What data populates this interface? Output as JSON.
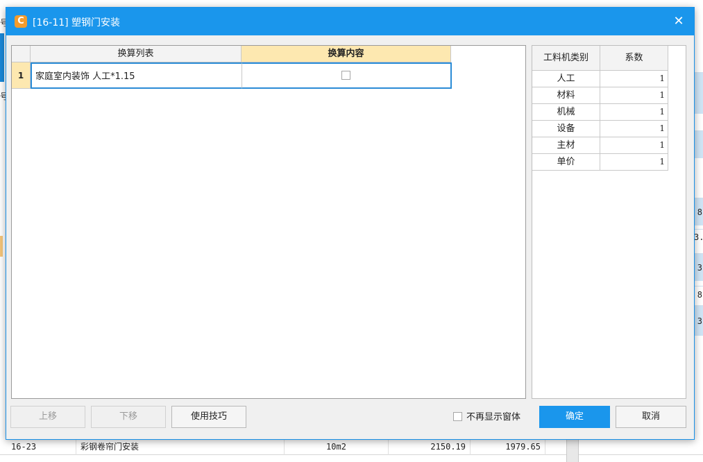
{
  "dialog": {
    "title": "[16-11] 塑钢门安装",
    "close_glyph": "✕",
    "app_icon_glyph": "C"
  },
  "left_grid": {
    "col_list": "换算列表",
    "col_content": "换算内容",
    "rows": [
      {
        "num": "1",
        "item": "家庭室内装饰 人工*1.15",
        "checked": false
      }
    ]
  },
  "right_grid": {
    "col_category": "工料机类别",
    "col_factor": "系数",
    "rows": [
      {
        "category": "人工",
        "factor": "1"
      },
      {
        "category": "材料",
        "factor": "1"
      },
      {
        "category": "机械",
        "factor": "1"
      },
      {
        "category": "设备",
        "factor": "1"
      },
      {
        "category": "主材",
        "factor": "1"
      },
      {
        "category": "单价",
        "factor": "1"
      }
    ]
  },
  "footer": {
    "move_up": "上移",
    "move_down": "下移",
    "tips": "使用技巧",
    "dont_show": "不再显示窗体",
    "ok": "确定",
    "cancel": "取消"
  },
  "background": {
    "row": {
      "code": "16-23",
      "name": "彩钢卷帘门安装",
      "unit": "10m2",
      "v1": "2150.19",
      "v2": "1979.65"
    },
    "right_fragments": [
      "8",
      "3.",
      "3",
      "8",
      "3"
    ],
    "left_fragments": [
      "号",
      "号"
    ]
  },
  "colors": {
    "accent": "#1a96ec",
    "header_highlight": "#fde8b0",
    "selection_border": "#2a8bd6"
  }
}
